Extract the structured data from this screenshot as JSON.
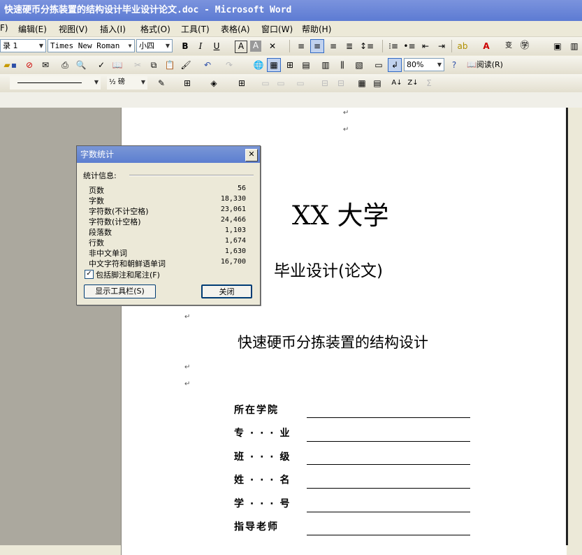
{
  "window": {
    "title": "快速硬币分拣装置的结构设计毕业设计论文.doc - Microsoft Word"
  },
  "menu": [
    "F)",
    "编辑(E)",
    "视图(V)",
    "插入(I)",
    "格式(O)",
    "工具(T)",
    "表格(A)",
    "窗口(W)",
    "帮助(H)"
  ],
  "toolbar1": {
    "style": "录 1",
    "font": "Times New Roman",
    "size": "小四"
  },
  "toolbar2": {
    "zoom": "80%",
    "read_label": "阅读(R)"
  },
  "toolbar3": {
    "line_weight": "½ 磅"
  },
  "document": {
    "university": "XX 大学",
    "subtitle": "毕业设计(论文)",
    "thesis_title": "快速硬币分拣装置的结构设计",
    "fields": [
      "所在学院",
      "专 · · · 业",
      "班 · · · 级",
      "姓 · · · 名",
      "学 · · · 号",
      "指导老师"
    ],
    "para_mark": "↵"
  },
  "dialog": {
    "title": "字数统计",
    "section_label": "统计信息:",
    "stats": [
      {
        "label": "页数",
        "value": "56"
      },
      {
        "label": "字数",
        "value": "18,330"
      },
      {
        "label": "字符数(不计空格)",
        "value": "23,061"
      },
      {
        "label": "字符数(计空格)",
        "value": "24,466"
      },
      {
        "label": "段落数",
        "value": "1,103"
      },
      {
        "label": "行数",
        "value": "1,674"
      },
      {
        "label": "非中文单词",
        "value": "1,630"
      },
      {
        "label": "中文字符和朝鲜语单词",
        "value": "16,700"
      }
    ],
    "checkbox_label": "包括脚注和尾注(F)",
    "checkbox_checked": true,
    "toolbar_button": "显示工具栏(S)",
    "close_button": "关闭"
  }
}
